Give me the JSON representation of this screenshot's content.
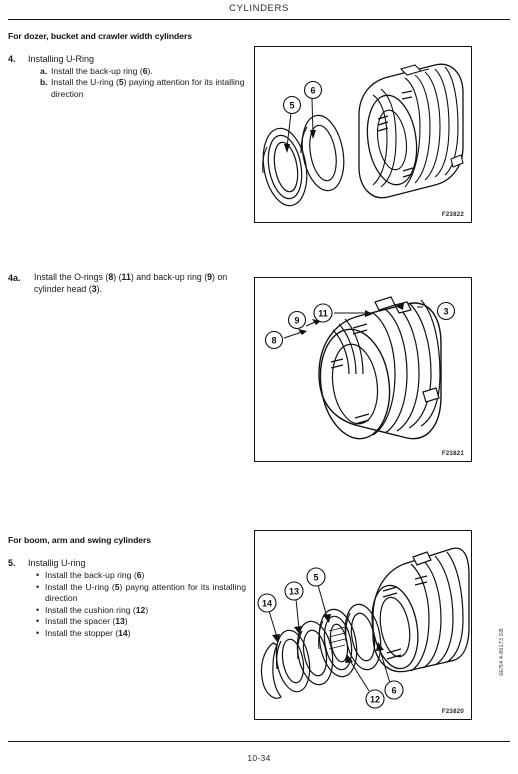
{
  "header": {
    "title": "CYLINDERS"
  },
  "footer": {
    "page_number": "10-34"
  },
  "side_margin_code": "6E/54 4-86173 GB",
  "sections": [
    {
      "heading": "For dozer, bucket and crawler width cylinders",
      "step_number": "4.",
      "step_title": "Installing U-Ring",
      "sub_steps": [
        {
          "marker": "a.",
          "text": "Install the back-up ring (6)."
        },
        {
          "marker": "b.",
          "text": "Install the U-ring (5) paying attention for its intalling direction"
        }
      ],
      "figure": {
        "code": "F23822",
        "callouts": [
          "5",
          "6"
        ]
      }
    },
    {
      "step_number": "4a.",
      "paragraph": "Install the O-rings (8) (11) and back-up ring (9) on cylinder head (3).",
      "figure": {
        "code": "F23821",
        "callouts": [
          "8",
          "9",
          "11",
          "3"
        ]
      }
    },
    {
      "heading": "For boom, arm and swing cylinders",
      "step_number": "5.",
      "step_title": "Installig U-ring",
      "bullets": [
        "Install the back-up ring (6)",
        "Install the U-ring (5) payng attention for its installing direction",
        "Install the cushion ring (12)",
        "Install the spacer (13)",
        "Install the stopper (14)"
      ],
      "figure": {
        "code": "F23820",
        "callouts": [
          "14",
          "13",
          "5",
          "12",
          "6"
        ]
      }
    }
  ],
  "colors": {
    "ink": "#111111",
    "paper": "#ffffff"
  }
}
